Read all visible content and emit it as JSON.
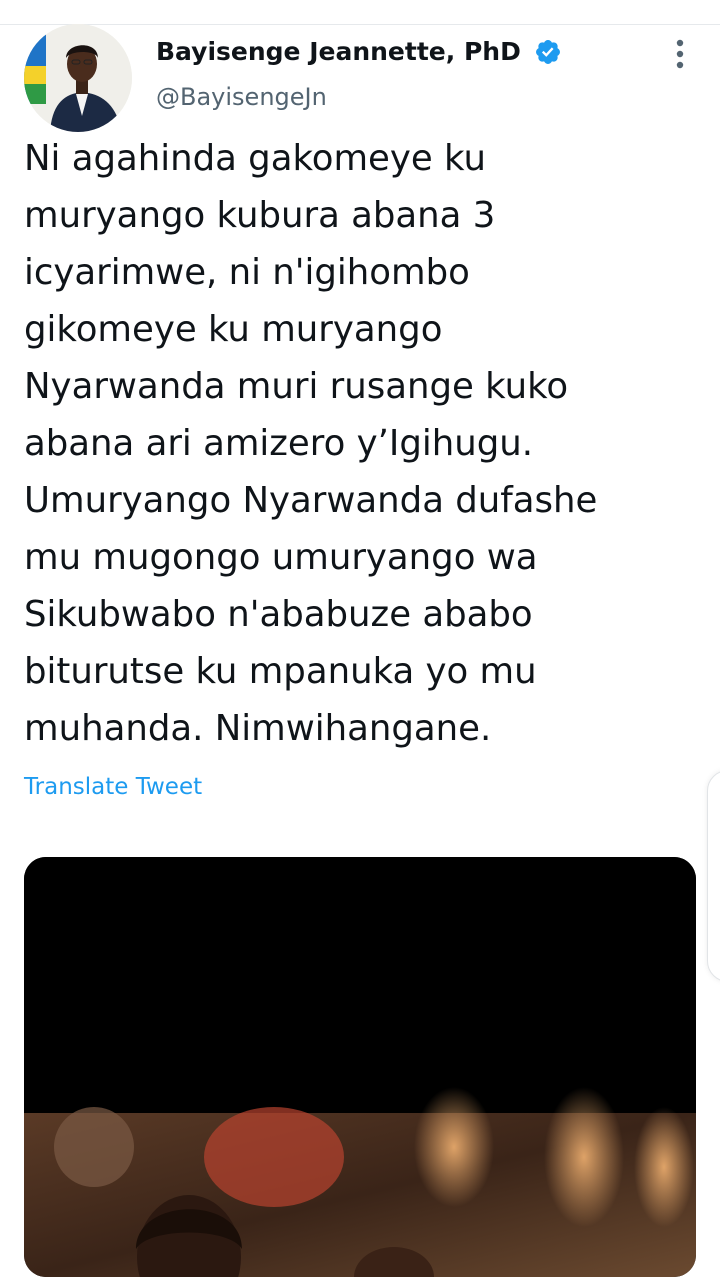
{
  "tweet": {
    "author": {
      "display_name": "Bayisenge Jeannette, PhD",
      "handle": "@BayisengeJn",
      "verified": true
    },
    "text_lines": [
      "Ni agahinda gakomeye ku",
      "muryango kubura abana 3",
      "icyarimwe, ni n'igihombo",
      "gikomeye ku muryango",
      "Nyarwanda muri rusange kuko",
      "abana ari amizero y’Igihugu.",
      "Umuryango Nyarwanda dufashe",
      "mu mugongo umuryango wa",
      "Sikubwabo n'ababuze ababo",
      "biturutse ku mpanuka yo mu",
      "muhanda. Nimwihangane."
    ],
    "translate_label": "Translate Tweet"
  },
  "icons": {
    "verified": "verified-badge-icon",
    "more": "more-vertical-icon"
  },
  "colors": {
    "accent": "#1d9bf0",
    "text_primary": "#0f1419",
    "text_secondary": "#536471"
  }
}
